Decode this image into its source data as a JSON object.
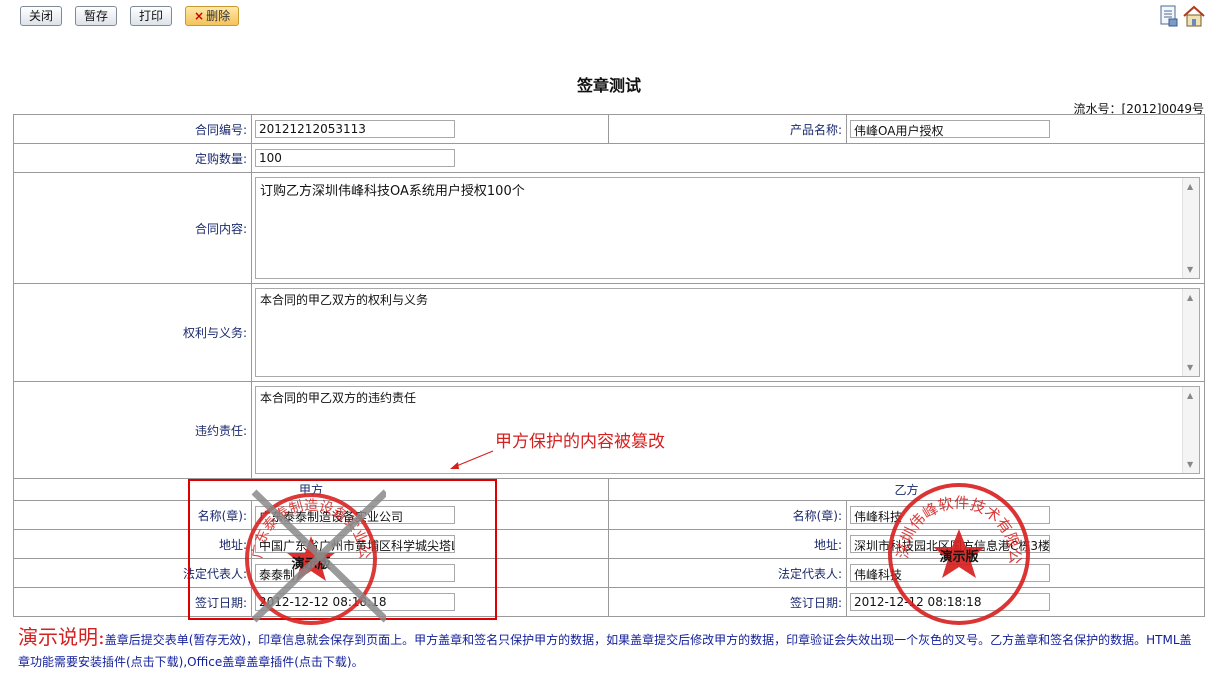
{
  "toolbar": {
    "close": "关闭",
    "save_draft": "暂存",
    "print": "打印",
    "delete": "删除",
    "delete_mark": "×"
  },
  "top_icons": [
    "document-icon",
    "home-icon"
  ],
  "title": "签章测试",
  "serial": "流水号：[2012]0049号",
  "fields": {
    "contract_no": {
      "label": "合同编号:",
      "value": "20121212053113"
    },
    "product_name": {
      "label": "产品名称:",
      "value": "伟峰OA用户授权"
    },
    "quantity": {
      "label": "定购数量:",
      "value": "100"
    },
    "content": {
      "label": "合同内容:",
      "value": "订购乙方深圳伟峰科技OA系统用户授权100个"
    },
    "rights": {
      "label": "权利与义务:",
      "value": "本合同的甲乙双方的权利与义务"
    },
    "liability": {
      "label": "违约责任:",
      "value": "本合同的甲乙双方的违约责任"
    }
  },
  "party_a": {
    "header": "甲方",
    "name": {
      "label": "名称(章):",
      "value": "广东泰泰制造设备实业公司"
    },
    "address": {
      "label": "地址:",
      "value": "中国广东省广州市黄埔区科学城尖塔L"
    },
    "rep": {
      "label": "法定代表人:",
      "value": "泰泰制"
    },
    "date": {
      "label": "签订日期:",
      "value": "2012-12-12 08:18:18"
    }
  },
  "party_b": {
    "header": "乙方",
    "name": {
      "label": "名称(章):",
      "value": "伟峰科技"
    },
    "address": {
      "label": "地址:",
      "value": "深圳市科技园北区国方信息港C栋3楼"
    },
    "rep": {
      "label": "法定代表人:",
      "value": "伟峰科技"
    },
    "date": {
      "label": "签订日期:",
      "value": "2012-12-12 08:18:18"
    }
  },
  "tamper_note": "甲方保护的内容被篡改",
  "note": {
    "heading": "演示说明:",
    "body": "盖章后提交表单(暂存无效)，印章信息就会保存到页面上。甲方盖章和签名只保护甲方的数据，如果盖章提交后修改甲方的数据，印章验证会失效出现一个灰色的叉号。乙方盖章和签名保护的数据。HTML盖章功能需要安装插件(点击下载),Office盖章盖章插件(点击下载)。"
  },
  "stamps": {
    "demo_text": "演示版",
    "stamp_a_text": "广东泰泰制造设备实业公司",
    "stamp_b_text": "深圳伟峰软件技术有限公司",
    "color": "#d81e1e",
    "invalid_mark_color": "#8a8a8a"
  },
  "colors": {
    "label": "#1a2a6e",
    "accent": "#d62020",
    "note": "#111e9a"
  }
}
